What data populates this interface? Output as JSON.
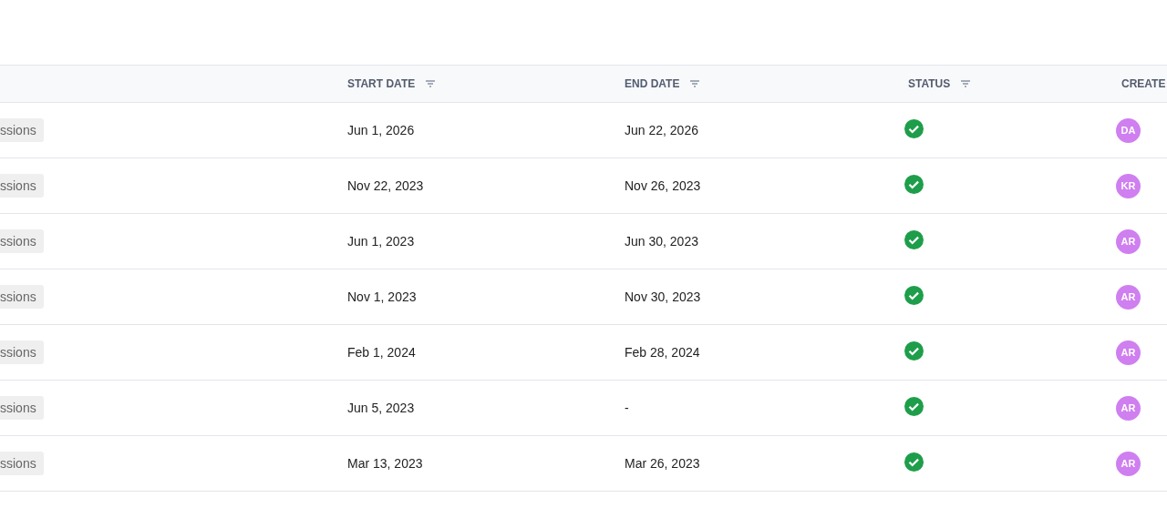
{
  "table": {
    "columns": [
      {
        "label": "START DATE",
        "filter": true
      },
      {
        "label": "END DATE",
        "filter": true
      },
      {
        "label": "STATUS",
        "filter": true
      },
      {
        "label": "CREATE",
        "filter": false
      }
    ],
    "rows": [
      {
        "tag": "ssions",
        "start_date": "Jun 1, 2026",
        "end_date": "Jun 22, 2026",
        "complete": true,
        "creator": "DA"
      },
      {
        "tag": "ssions",
        "start_date": "Nov 22, 2023",
        "end_date": "Nov 26, 2023",
        "complete": true,
        "creator": "KR"
      },
      {
        "tag": "ssions",
        "start_date": "Jun 1, 2023",
        "end_date": "Jun 30, 2023",
        "complete": true,
        "creator": "AR"
      },
      {
        "tag": "ssions",
        "start_date": "Nov 1, 2023",
        "end_date": "Nov 30, 2023",
        "complete": true,
        "creator": "AR"
      },
      {
        "tag": "ssions",
        "start_date": "Feb 1, 2024",
        "end_date": "Feb 28, 2024",
        "complete": true,
        "creator": "AR"
      },
      {
        "tag": "ssions",
        "start_date": "Jun 5, 2023",
        "end_date": "-",
        "complete": true,
        "creator": "AR"
      },
      {
        "tag": "ssions",
        "start_date": "Mar 13, 2023",
        "end_date": "Mar 26, 2023",
        "complete": true,
        "creator": "AR"
      }
    ]
  }
}
